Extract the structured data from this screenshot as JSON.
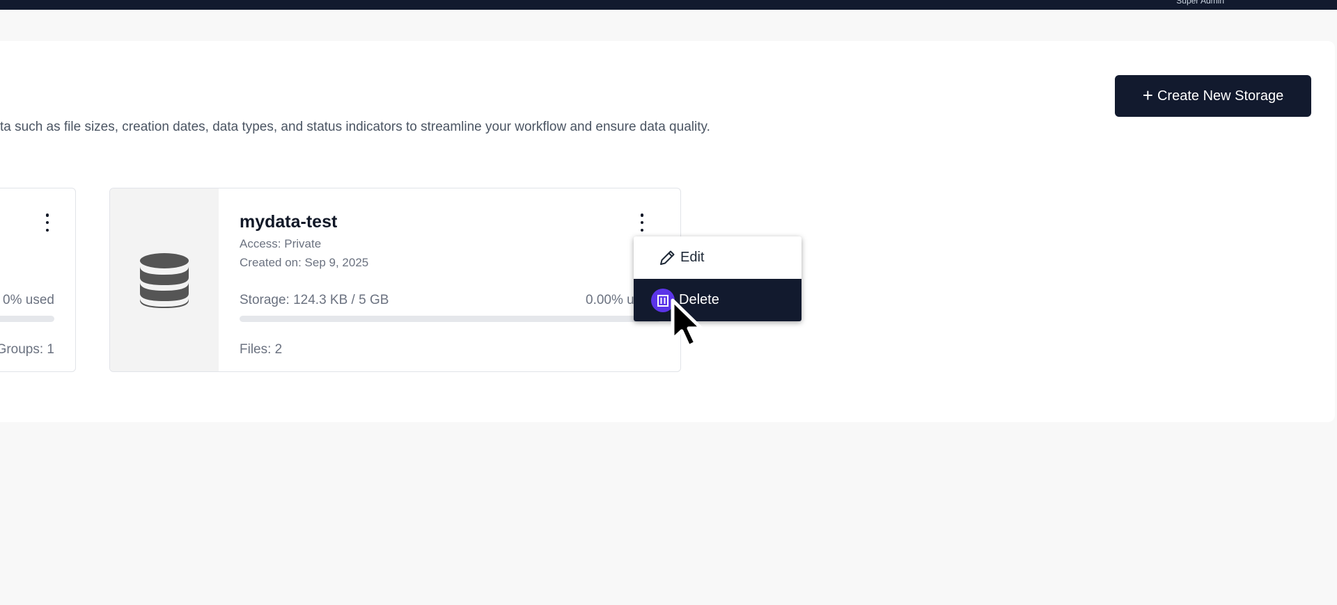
{
  "topbar": {
    "user_label": "Super Admin"
  },
  "header": {
    "create_button_label": "Create New Storage",
    "description": "ta such as file sizes, creation dates, data types, and status indicators to streamline your workflow and ensure data quality."
  },
  "cards": [
    {
      "usage": "0% used",
      "groups": "Groups: 1"
    },
    {
      "name": "mydata-test",
      "access": "Access: Private",
      "created": "Created on: Sep 9, 2025",
      "storage": "Storage: 124.3 KB / 5 GB",
      "usage": "0.00% u",
      "usage_fraction": 0.0,
      "files": "Files: 2",
      "icon": "database-icon"
    }
  ],
  "context_menu": {
    "items": [
      {
        "label": "Edit",
        "icon": "pencil-icon"
      },
      {
        "label": "Delete",
        "icon": "trash-icon"
      }
    ]
  },
  "colors": {
    "dark_navy": "#121a2e",
    "highlight_purple": "#5b34e8",
    "muted_text": "#6b7280"
  }
}
